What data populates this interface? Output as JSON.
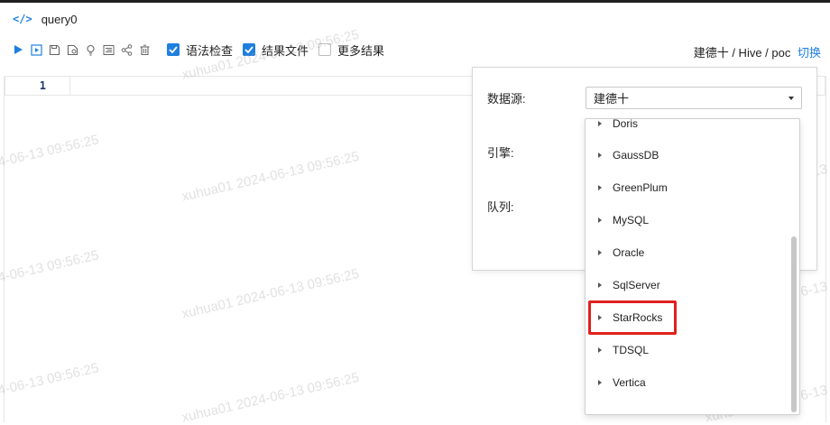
{
  "tab": {
    "title": "query0",
    "icon": "code-icon"
  },
  "toolbar": {
    "icons": [
      "run-icon",
      "run-selected-icon",
      "save-icon",
      "save-as-icon",
      "bulb-icon",
      "format-icon",
      "share-icon",
      "delete-icon"
    ],
    "checks": [
      {
        "label": "语法检查",
        "checked": true
      },
      {
        "label": "结果文件",
        "checked": true
      },
      {
        "label": "更多结果",
        "checked": false
      }
    ],
    "accent": "#1f7fe0"
  },
  "breadcrumb": {
    "path": "建德十 / Hive / poc",
    "switch": "切换"
  },
  "editor": {
    "line_number": "1"
  },
  "panel": {
    "datasource_label": "数据源:",
    "engine_label": "引擎:",
    "queue_label": "队列:",
    "datasource_value": "建德十"
  },
  "dropdown": {
    "items": [
      "Doris",
      "GaussDB",
      "GreenPlum",
      "MySQL",
      "Oracle",
      "SqlServer",
      "StarRocks",
      "TDSQL",
      "Vertica"
    ],
    "highlighted": "StarRocks",
    "highlight_color": "#e02020"
  },
  "watermark": {
    "text": "xuhua01 2024-06-13 09:56:25",
    "partial": "4-06-13 09:56:25"
  }
}
